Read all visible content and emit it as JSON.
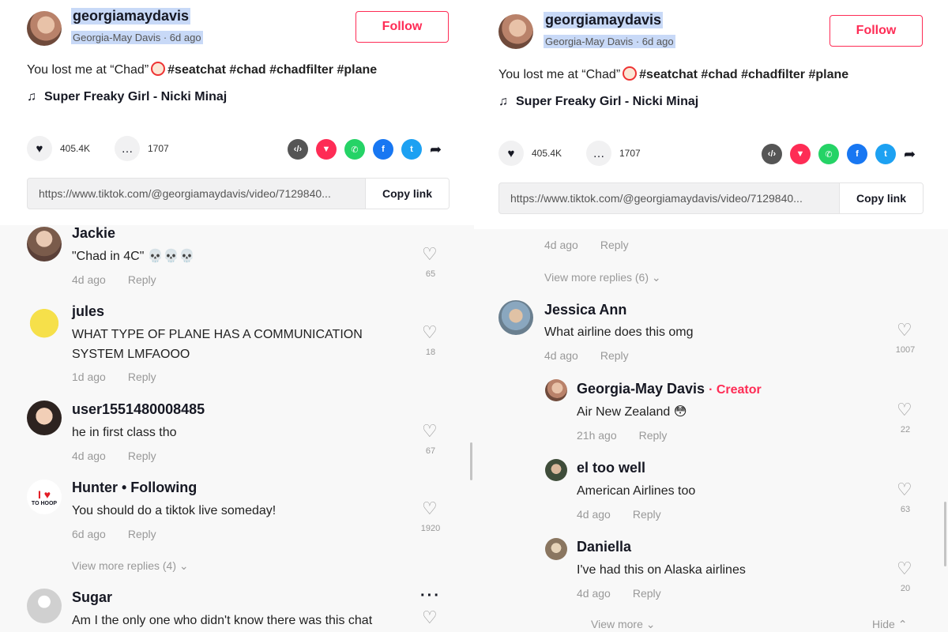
{
  "post": {
    "username": "georgiamaydavis",
    "meta": "Georgia-May Davis · 6d ago",
    "follow_label": "Follow",
    "caption_text": "You lost me at “Chad”",
    "caption_tags": "#seatchat #chad #chadfilter #plane",
    "music": "Super Freaky Girl - Nicki Minaj",
    "likes": "405.4K",
    "comments": "1707",
    "url": "https://www.tiktok.com/@georgiamaydavis/video/7129840...",
    "copy_label": "Copy link",
    "share_icons": [
      "embed-icon",
      "send-icon",
      "whatsapp-icon",
      "facebook-icon",
      "twitter-icon",
      "share-arrow-icon"
    ],
    "colors": {
      "accent": "#fe2c55",
      "whatsapp": "#25d366",
      "facebook": "#1877f2",
      "twitter": "#1da1f2",
      "embed": "#555555"
    }
  },
  "left_comments": [
    {
      "name": "Jackie",
      "text": "\"Chad in 4C\" 💀💀💀",
      "time": "4d ago",
      "reply": "Reply",
      "likes": "65"
    },
    {
      "name": "jules",
      "text": "WHAT TYPE OF PLANE HAS A COMMUNICATION SYSTEM LMFAOOO",
      "time": "1d ago",
      "reply": "Reply",
      "likes": "18"
    },
    {
      "name": "user1551480008485",
      "text": "he in first class tho",
      "time": "4d ago",
      "reply": "Reply",
      "likes": "67"
    },
    {
      "name": "Hunter • Following",
      "text": "You should do a tiktok live someday!",
      "time": "6d ago",
      "reply": "Reply",
      "likes": "1920",
      "avatar_text": "TO HOOP"
    },
    {
      "name": "Sugar",
      "text": "Am I the only one who didn't know there was this chat",
      "time": "",
      "reply": "",
      "likes": ""
    }
  ],
  "left_view_more": "View more replies (4)",
  "right_top": {
    "time": "4d ago",
    "reply": "Reply",
    "view_more": "View more replies (6)"
  },
  "right_comments": [
    {
      "name": "Jessica Ann",
      "text": "What airline does this omg",
      "time": "4d ago",
      "reply": "Reply",
      "likes": "1007"
    },
    {
      "name": "Georgia-May Davis",
      "creator": "· Creator",
      "text": "Air New Zealand 😳",
      "time": "21h ago",
      "reply": "Reply",
      "likes": "22"
    },
    {
      "name": "el too well",
      "text": "American Airlines too",
      "time": "4d ago",
      "reply": "Reply",
      "likes": "63"
    },
    {
      "name": "Daniella",
      "text": "I've had this on Alaska airlines",
      "time": "4d ago",
      "reply": "Reply",
      "likes": "20"
    }
  ],
  "right_bottom": {
    "view_more": "View more",
    "hide": "Hide"
  }
}
